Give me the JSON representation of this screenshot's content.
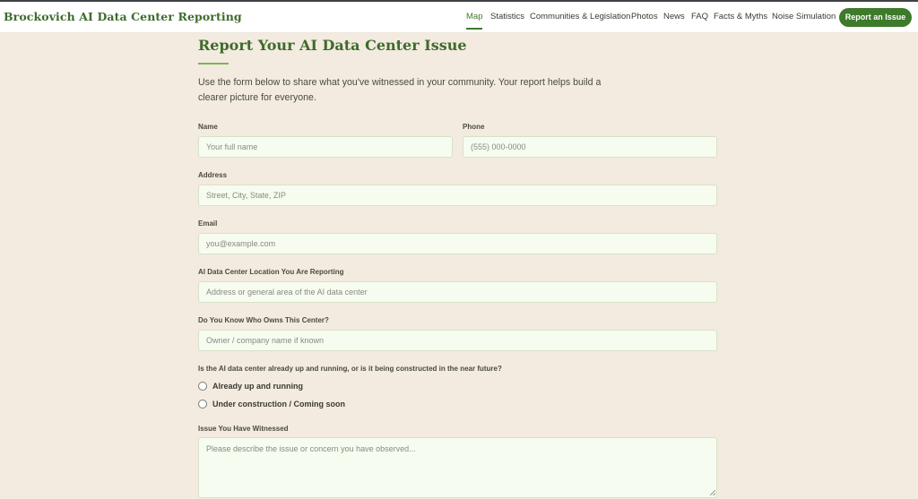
{
  "header": {
    "brand": "Brockovich AI Data Center Reporting",
    "nav": [
      "Map",
      "Statistics",
      "Communities & Legislation",
      "Photos",
      "News",
      "FAQ",
      "Facts & Myths",
      "Noise Simulation"
    ],
    "active_nav": "Map",
    "cta_label": "Report an Issue"
  },
  "main": {
    "title": "Report Your AI Data Center Issue",
    "intro": "Use the form below to share what you've witnessed in your community. Your report helps build a clearer picture for everyone."
  },
  "form": {
    "name": {
      "label": "Name",
      "placeholder": "Your full name",
      "value": ""
    },
    "phone": {
      "label": "Phone",
      "placeholder": "(555) 000-0000",
      "value": ""
    },
    "address": {
      "label": "Address",
      "placeholder": "Street, City, State, ZIP",
      "value": ""
    },
    "email": {
      "label": "Email",
      "placeholder": "you@example.com",
      "value": ""
    },
    "location": {
      "label": "AI Data Center Location You Are Reporting",
      "placeholder": "Address or general area of the AI data center",
      "value": ""
    },
    "owner": {
      "label": "Do You Know Who Owns This Center?",
      "placeholder": "Owner / company name if known",
      "value": ""
    },
    "status": {
      "label": "Is the AI data center already up and running, or is it being constructed in the near future?",
      "options": [
        "Already up and running",
        "Under construction / Coming soon"
      ],
      "selected": null
    },
    "issue": {
      "label": "Issue You Have Witnessed",
      "placeholder": "Please describe the issue or concern you have observed...",
      "value": ""
    }
  }
}
